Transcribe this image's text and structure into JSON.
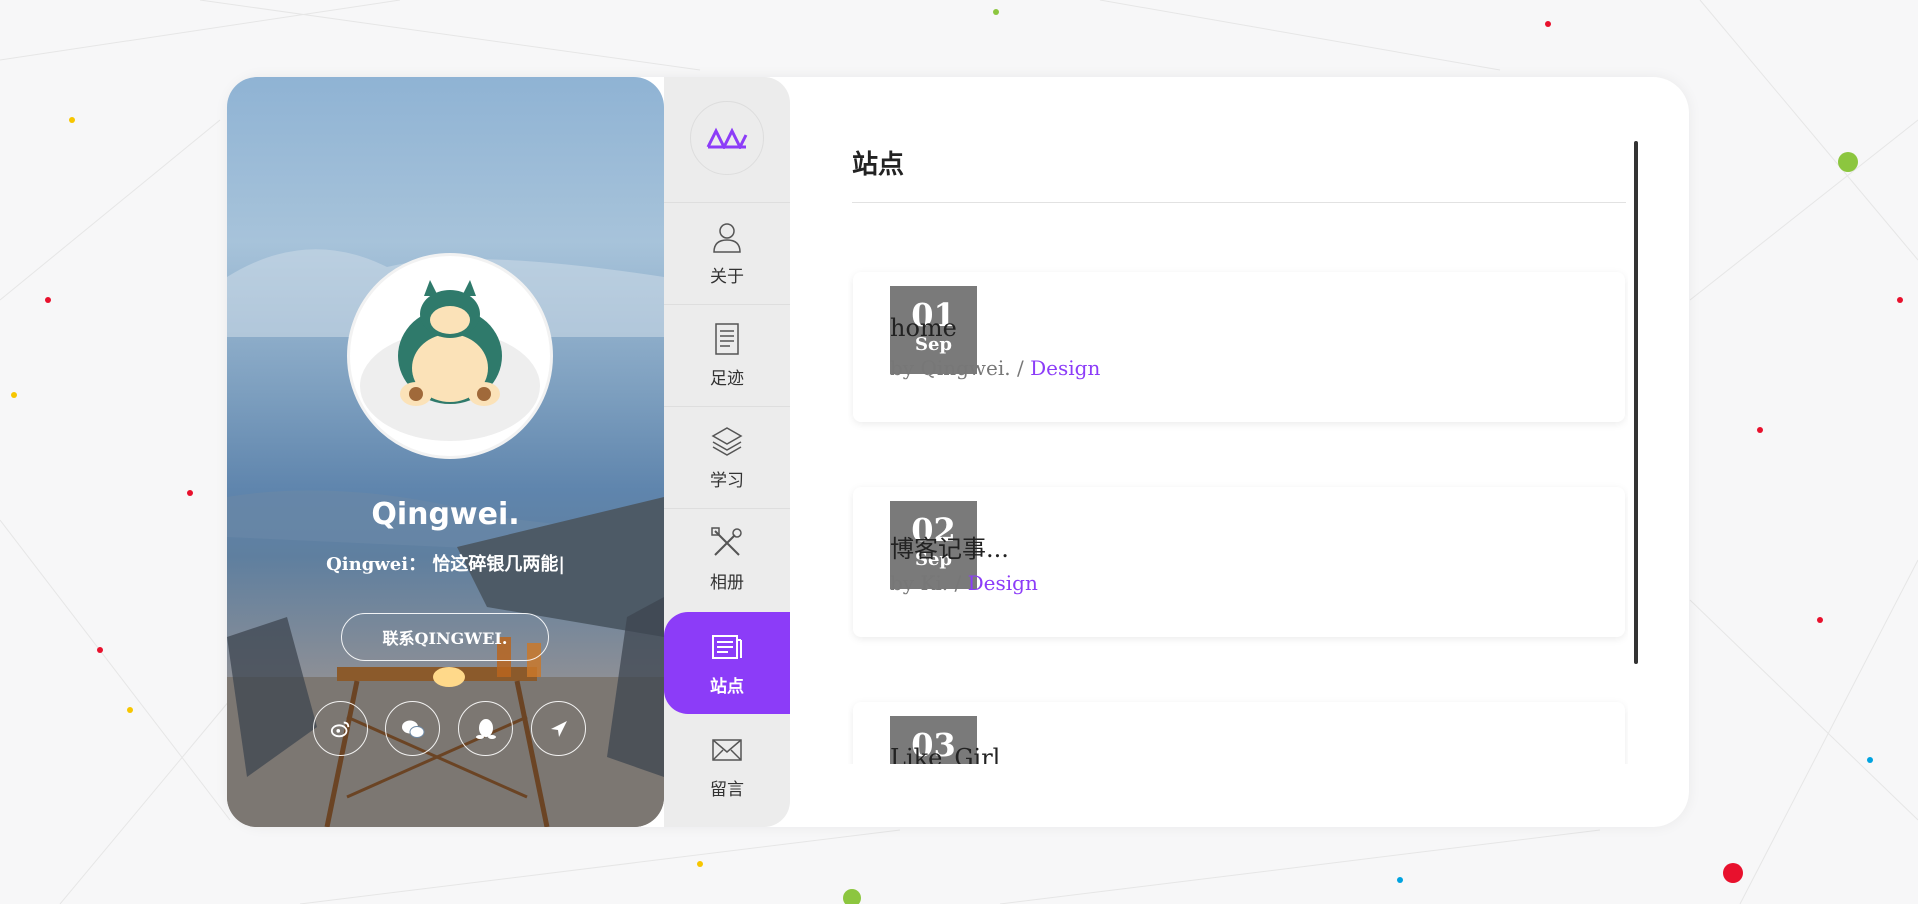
{
  "profile": {
    "name": "Qingwei.",
    "motto": "Qingwei： 恰这碎银几两能|",
    "contact_label": "联系QINGWEI.",
    "socials": [
      {
        "icon": "weibo-icon"
      },
      {
        "icon": "wechat-icon"
      },
      {
        "icon": "qq-icon"
      },
      {
        "icon": "send-icon"
      }
    ]
  },
  "nav": {
    "logo_icon": "site-logo-icon",
    "items": [
      {
        "label": "关于",
        "icon": "user-icon",
        "active": false
      },
      {
        "label": "足迹",
        "icon": "document-icon",
        "active": false
      },
      {
        "label": "学习",
        "icon": "layers-icon",
        "active": false
      },
      {
        "label": "相册",
        "icon": "tools-icon",
        "active": false
      },
      {
        "label": "站点",
        "icon": "news-icon",
        "active": true
      },
      {
        "label": "留言",
        "icon": "mail-icon",
        "active": false
      }
    ]
  },
  "content": {
    "title": "站点",
    "posts": [
      {
        "day": "01",
        "month": "Sep",
        "title": "home",
        "by": "by Qingwei. / ",
        "category": "Design"
      },
      {
        "day": "02",
        "month": "Sep",
        "title": "博客记事...",
        "by": "by Ki. / ",
        "category": "Design"
      },
      {
        "day": "03",
        "month": "",
        "title": "Like_Girl",
        "by": "",
        "category": ""
      }
    ]
  },
  "colors": {
    "accent": "#8c3cf8",
    "date_badge": "#7a7a7a",
    "nav_bg": "#ececec"
  }
}
